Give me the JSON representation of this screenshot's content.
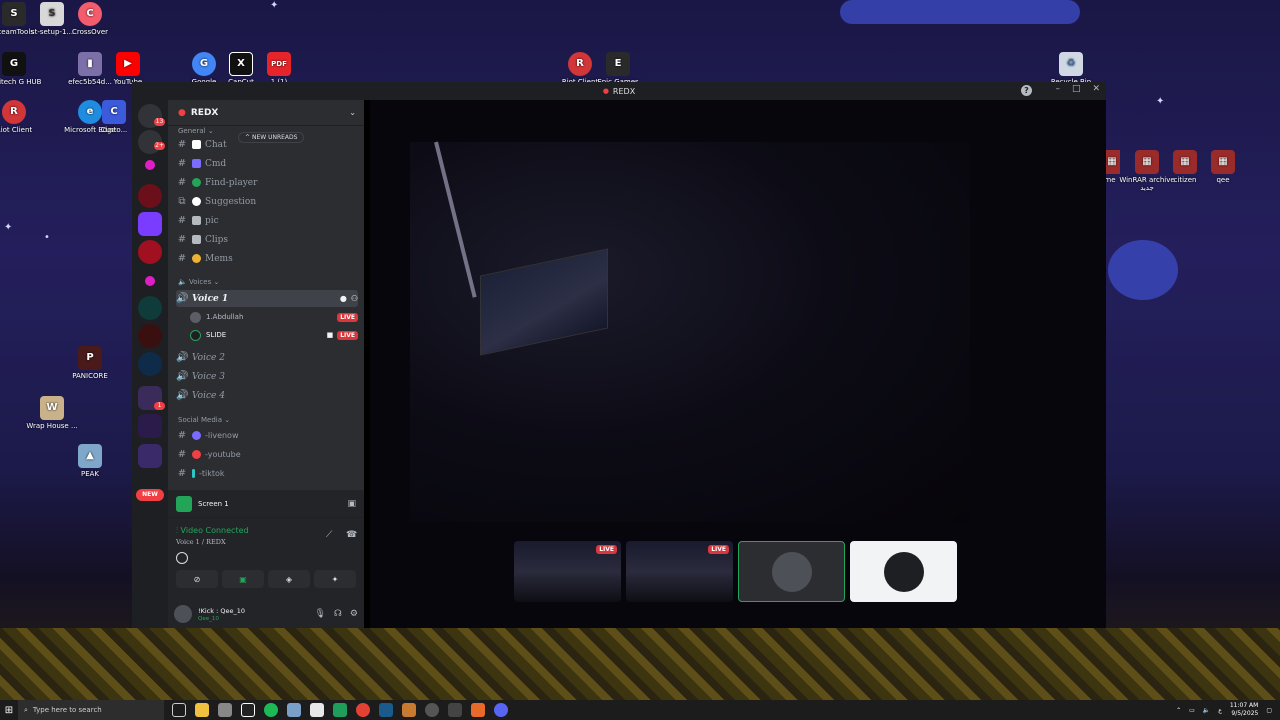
{
  "desktop": {
    "icons": [
      {
        "label": "SteamTools",
        "color": "#2a2a2a",
        "glyph": "S"
      },
      {
        "label": "st-setup-1...",
        "color": "#d8d8d8",
        "glyph": "S"
      },
      {
        "label": "CrossOver",
        "color": "#f25c6c",
        "glyph": "C"
      },
      {
        "label": "Logitech G HUB",
        "color": "#111111",
        "glyph": "G"
      },
      {
        "label": "efec5b54d...",
        "color": "#7d6fa8",
        "glyph": "▮"
      },
      {
        "label": "YouTube",
        "color": "#ff0000",
        "glyph": "▶"
      },
      {
        "label": "Google",
        "color": "#4285f4",
        "glyph": "G"
      },
      {
        "label": "CapCut",
        "color": "#111111",
        "glyph": "X"
      },
      {
        "label": "1 (1)",
        "color": "#e5252a",
        "glyph": "PDF"
      },
      {
        "label": "Riot Client",
        "color": "#d13639",
        "glyph": "R"
      },
      {
        "label": "Epic Games",
        "color": "#2a2a2a",
        "glyph": "E"
      },
      {
        "label": "Recycle Bin",
        "color": "#cfd8e3",
        "glyph": "♻"
      },
      {
        "label": "Riot Client",
        "color": "#d13639",
        "glyph": "R"
      },
      {
        "label": "Microsoft Edge",
        "color": "#1f8ce0",
        "glyph": "e"
      },
      {
        "label": "Custo...",
        "color": "#3b5bdb",
        "glyph": "C"
      },
      {
        "label": "PANICORE",
        "color": "#4a1a1a",
        "glyph": "P"
      },
      {
        "label": "Wrap House ...",
        "color": "#c9b28a",
        "glyph": "W"
      },
      {
        "label": "PEAK",
        "color": "#7fa7c9",
        "glyph": "▲"
      },
      {
        "label": "me",
        "color": "#9a2b2b",
        "glyph": "▦"
      },
      {
        "label": "WinRAR archive جديد",
        "color": "#9a2b2b",
        "glyph": "▦"
      },
      {
        "label": "citizen",
        "color": "#9a2b2b",
        "glyph": "▦"
      },
      {
        "label": "qee",
        "color": "#9a2b2b",
        "glyph": "▦"
      }
    ]
  },
  "window": {
    "title": "REDX",
    "controls": {
      "minimize": "–",
      "maximize": "□",
      "close": "✕"
    },
    "help": "?"
  },
  "servers": {
    "badges": [
      "13",
      "2+",
      "1"
    ],
    "new_label": "NEW"
  },
  "guild": {
    "name": "REDX",
    "new_unreads": "NEW UNREADS",
    "categories": {
      "general": "General",
      "voices": "Voices",
      "social": "Social Media"
    },
    "text_channels": [
      {
        "name": "Chat",
        "emoji_color": "#ffffff"
      },
      {
        "name": "Cmd",
        "emoji_color": "#7b6cff"
      },
      {
        "name": "Find-player",
        "emoji_color": "#23a559"
      },
      {
        "name": "Suggestion",
        "emoji_color": "#ffffff"
      },
      {
        "name": "pic",
        "emoji_color": "#b5bac1"
      },
      {
        "name": "Clips",
        "emoji_color": "#b5bac1"
      },
      {
        "name": "Mems",
        "emoji_color": "#f0b232"
      }
    ],
    "voice_channels": [
      {
        "name": "Voice 1"
      },
      {
        "name": "Voice 2"
      },
      {
        "name": "Voice 3"
      },
      {
        "name": "Voice 4"
      }
    ],
    "voice_members": [
      {
        "name": "1.Abdullah",
        "badge": "LIVE"
      },
      {
        "name": "SLIDE",
        "badge": "LIVE"
      }
    ],
    "social_channels": [
      {
        "name": "-livenow",
        "dot": "#7b6cff"
      },
      {
        "name": "-youtube",
        "dot": "#f23f43"
      },
      {
        "name": "-tiktok",
        "dot": "#2dc6c6"
      }
    ]
  },
  "voice_panel": {
    "screen_label": "Screen 1",
    "status": "Video Connected",
    "location": "Voice 1 / REDX"
  },
  "user": {
    "name": "!Kick : Qee_10",
    "status": "Qee_10"
  },
  "stage": {
    "thumbnails": [
      {
        "type": "screen",
        "badge": "LIVE"
      },
      {
        "type": "screen",
        "badge": "LIVE"
      },
      {
        "type": "camera",
        "badge": ""
      },
      {
        "type": "avatar",
        "badge": ""
      }
    ]
  },
  "taskbar": {
    "search_placeholder": "Type here to search",
    "time": "11:07 AM",
    "date": "9/5/2025",
    "lang": "ع"
  }
}
